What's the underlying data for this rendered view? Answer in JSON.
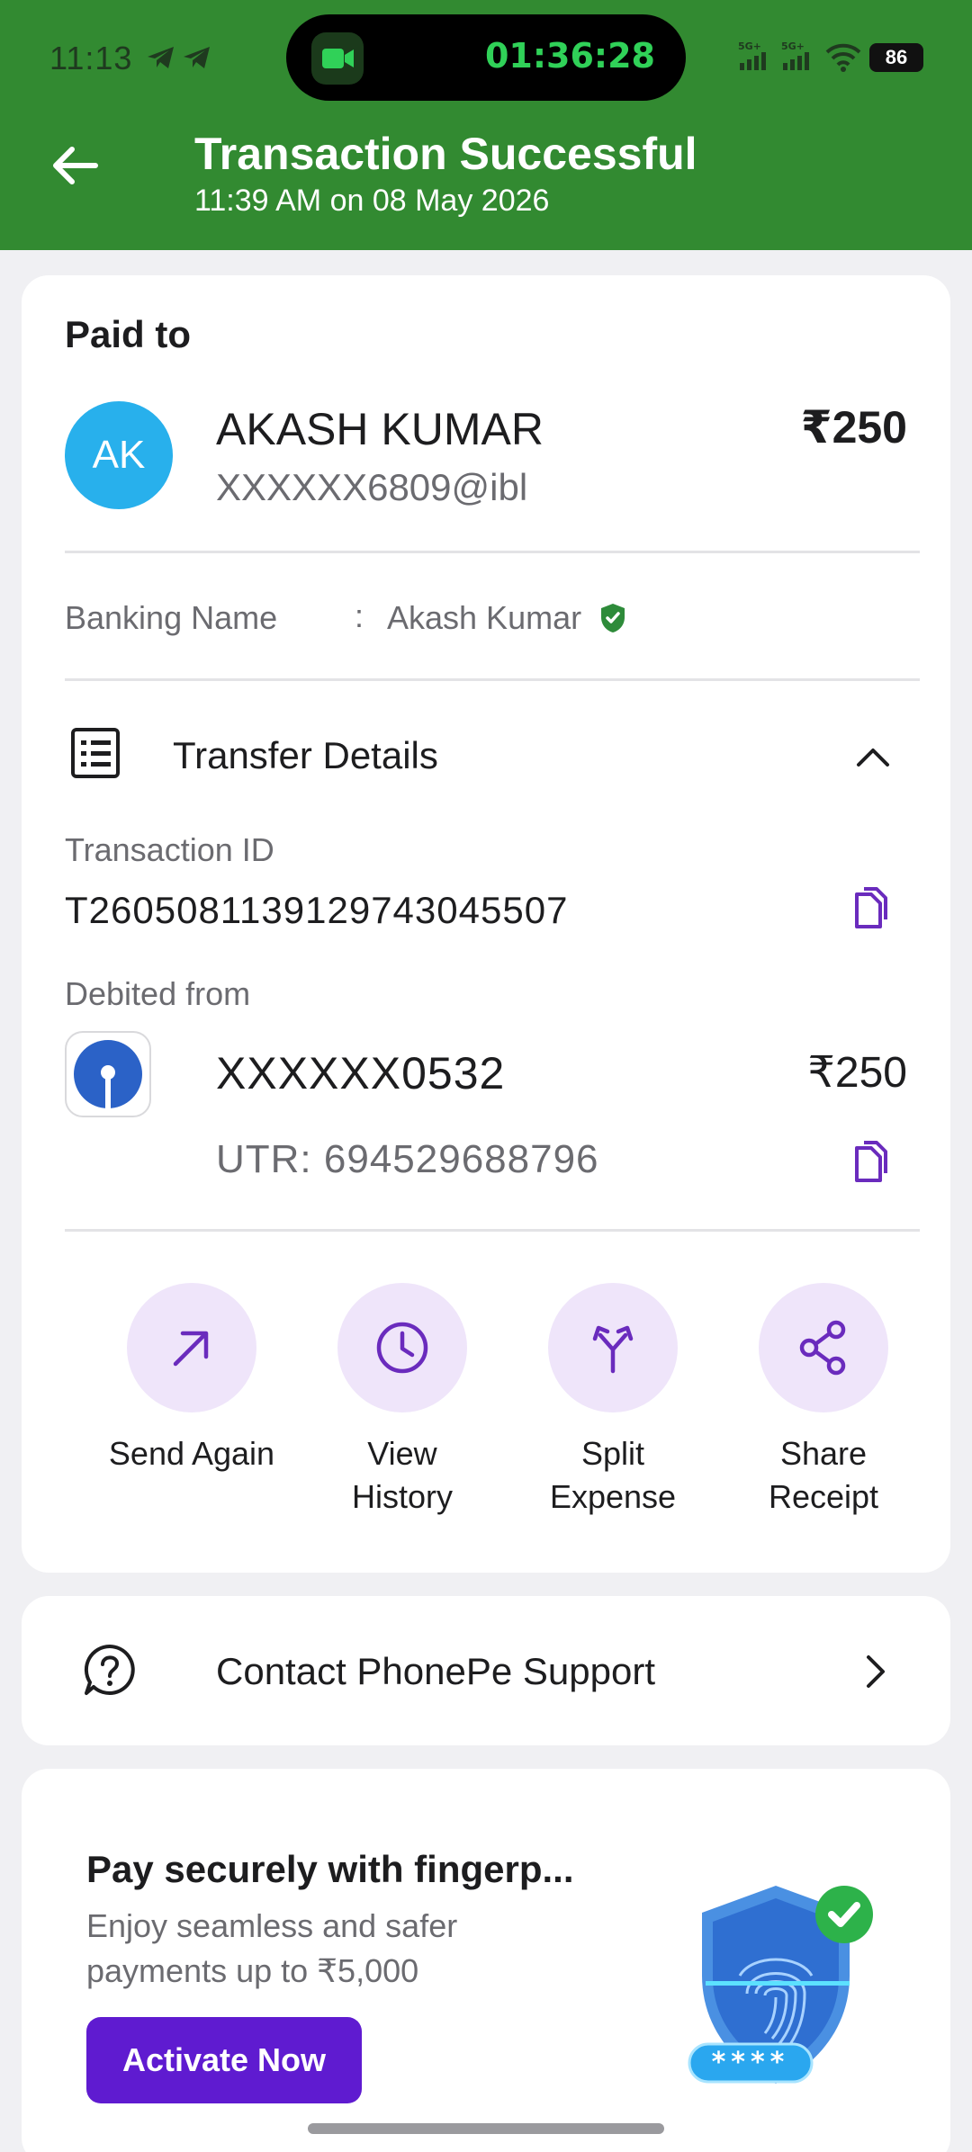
{
  "status_bar": {
    "time": "11:13",
    "call_timer": "01:36:28",
    "network_1": "5G+",
    "network_2": "5G+",
    "battery": "86",
    "icons": [
      "telegram-icon",
      "telegram-icon",
      "video-call-icon",
      "signal-icon",
      "signal-icon",
      "wifi-icon",
      "battery-icon"
    ]
  },
  "header": {
    "title": "Transaction Successful",
    "subtitle": "11:39 AM on 08 May 2026",
    "back_icon": "back-arrow-icon",
    "background": "#328a31"
  },
  "payment": {
    "section_title": "Paid to",
    "avatar_initials": "AK",
    "avatar_color": "#28b0ec",
    "payee_name": "AKASH KUMAR",
    "payee_vpa": "XXXXXX6809@ibl",
    "amount": "₹250",
    "banking_name_label": "Banking Name",
    "banking_name_separator": ":",
    "banking_name_value": "Akash Kumar",
    "verified_icon": "verified-shield-icon"
  },
  "transfer": {
    "label": "Transfer Details",
    "expanded": true,
    "transaction_id_label": "Transaction ID",
    "transaction_id": "T2605081139129743045507",
    "debited_from_label": "Debited from",
    "account": "XXXXXX0532",
    "account_amount": "₹250",
    "utr": "UTR: 694529688796"
  },
  "actions": [
    {
      "label": "Send Again",
      "icon": "arrow-up-right-icon"
    },
    {
      "label": "View History",
      "icon": "clock-icon"
    },
    {
      "label": "Split Expense",
      "icon": "split-icon"
    },
    {
      "label": "Share Receipt",
      "icon": "share-icon"
    }
  ],
  "support": {
    "label": "Contact PhonePe Support",
    "icon": "help-circle-icon"
  },
  "promo": {
    "title": "Pay securely with fingerp...",
    "text": "Enjoy seamless and safer payments up to ₹5,000",
    "button": "Activate Now",
    "pin_mask": "****",
    "accent": "#5f1bd0"
  },
  "colors": {
    "primary_purple": "#5f1bd0",
    "icon_purple": "#6a2bbd",
    "action_bg": "#efe5fa",
    "success_green": "#328a31"
  }
}
